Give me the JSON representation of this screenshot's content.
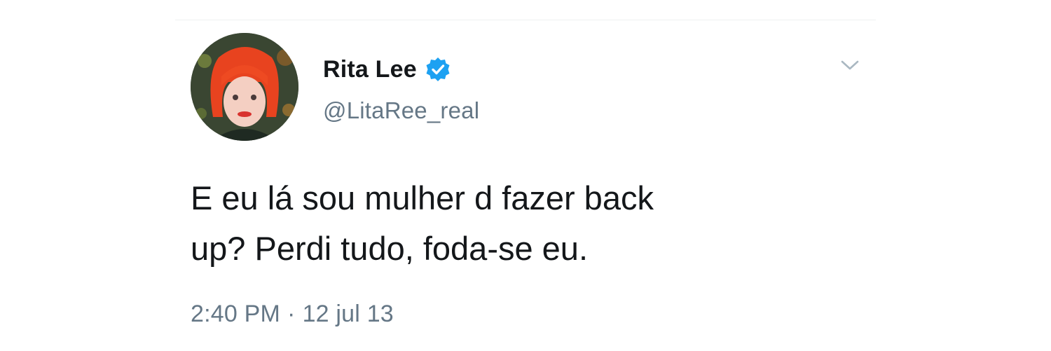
{
  "tweet": {
    "author": {
      "display_name": "Rita Lee",
      "handle": "@LitaRee_real",
      "verified": true,
      "verified_icon": "verified-badge-icon",
      "avatar_icon": "profile-avatar"
    },
    "text_lines": [
      "E eu lá sou mulher d fazer back",
      "up? Perdi tudo, foda-se eu."
    ],
    "time": "2:40 PM",
    "separator": "·",
    "date": "12 jul 13",
    "menu_icon": "chevron-down-icon"
  },
  "colors": {
    "text_primary": "#14171a",
    "text_secondary": "#657786",
    "verified_blue": "#1da1f2",
    "background": "#ffffff"
  }
}
